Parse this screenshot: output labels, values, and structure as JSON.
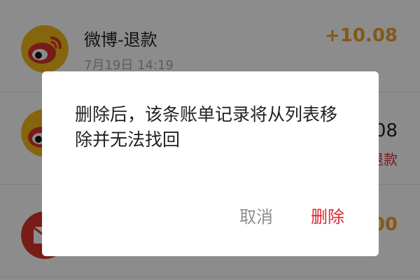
{
  "records": [
    {
      "title": "微博-退款",
      "time": "7月19日 14:19",
      "amount": "+10.08",
      "status": "",
      "icon": "weibo-icon"
    },
    {
      "title": "",
      "time": "",
      "amount": ".08",
      "status": "退款",
      "icon": "weibo-icon"
    },
    {
      "title": "",
      "time": "",
      "amount": ".00",
      "status": "",
      "icon": "envelope-icon"
    }
  ],
  "dialog": {
    "message": "删除后，该条账单记录将从列表移除并无法找回",
    "cancel_label": "取消",
    "delete_label": "删除"
  },
  "colors": {
    "amount_positive": "#f1a02c",
    "delete_red": "#e0232d",
    "cancel_gray": "#8d8d8d",
    "weibo_yellow": "#f5b81c",
    "weibo_red": "#d9342b"
  }
}
